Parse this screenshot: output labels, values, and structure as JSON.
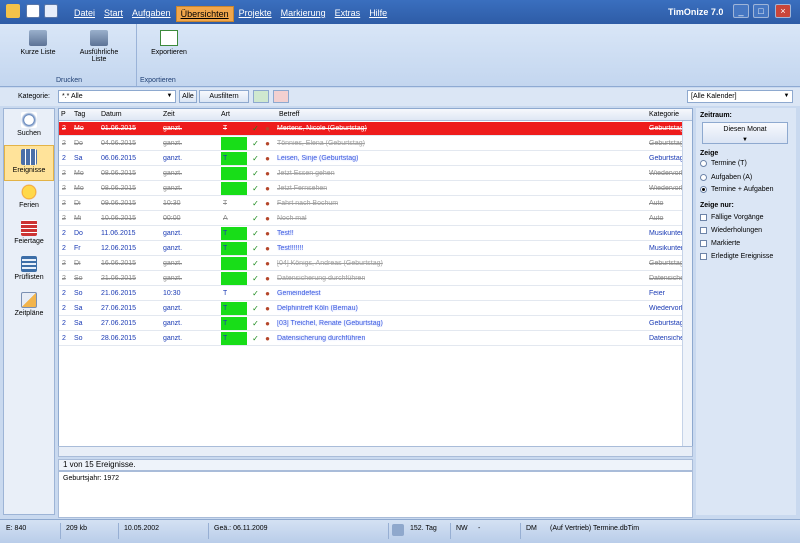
{
  "app": {
    "title": "TimOnize 7.0"
  },
  "menu": {
    "items": [
      "Datei",
      "Start",
      "Aufgaben",
      "Übersichten",
      "Projekte",
      "Markierung",
      "Extras",
      "Hilfe"
    ],
    "active": "Übersichten"
  },
  "ribbon": {
    "kurze_liste": "Kurze Liste",
    "ausfuehrliche_liste_1": "Ausführliche",
    "ausfuehrliche_liste_2": "Liste",
    "exportieren": "Exportieren",
    "group_drucken": "Drucken",
    "group_exportieren": "Exportieren"
  },
  "filter": {
    "kategorie_label": "Kategorie:",
    "kategorie_value": "*.* Alle",
    "alle_button": "Alle",
    "ausfiltern_button": "Ausfiltern",
    "kalender_value": "[Alle Kalender]"
  },
  "sidebar": {
    "items": [
      {
        "label": "Suchen",
        "icon": "magnifier-icon"
      },
      {
        "label": "Ereignisse",
        "icon": "events-grid-icon",
        "selected": true
      },
      {
        "label": "Ferien",
        "icon": "sun-icon"
      },
      {
        "label": "Feiertage",
        "icon": "calendar-icon"
      },
      {
        "label": "Prüflisten",
        "icon": "checklist-icon"
      },
      {
        "label": "Zeitpläne",
        "icon": "schedule-icon"
      }
    ]
  },
  "table": {
    "columns": [
      "P",
      "Tag",
      "Datum",
      "Zeit",
      "Art",
      "Betreff",
      "Kategorie"
    ],
    "rows": [
      {
        "p": "2",
        "tag": "Mo",
        "datum": "01.06.2015",
        "zeit": "ganzt.",
        "art": "T",
        "betreff": "Mertens, Nicole (Geburtstag)",
        "kategorie": "Geburtstag",
        "state": "sel",
        "artgreen": false
      },
      {
        "p": "2",
        "tag": "Do",
        "datum": "04.06.2015",
        "zeit": "ganzt.",
        "art": "",
        "betreff": "Tönnies, Elena (Geburtstag)",
        "kategorie": "Geburtstag",
        "state": "done",
        "artgreen": true
      },
      {
        "p": "2",
        "tag": "Sa",
        "datum": "06.06.2015",
        "zeit": "ganzt.",
        "art": "T",
        "betreff": "Leisen, Sinje (Geburtstag)",
        "kategorie": "Geburtstag",
        "state": "blue",
        "artgreen": true
      },
      {
        "p": "2",
        "tag": "Mo",
        "datum": "08.06.2015",
        "zeit": "ganzt.",
        "art": "",
        "betreff": "Jetzt Essen gehen",
        "kategorie": "Wiedervorl...",
        "state": "done",
        "artgreen": true
      },
      {
        "p": "2",
        "tag": "Mo",
        "datum": "08.06.2015",
        "zeit": "ganzt.",
        "art": "",
        "betreff": "Jetzt Fernsehen",
        "kategorie": "Wiedervorl...",
        "state": "done",
        "artgreen": true
      },
      {
        "p": "2",
        "tag": "Di",
        "datum": "09.06.2015",
        "zeit": "10:30",
        "art": "T",
        "betreff": "Fahrt nach Bochum",
        "kategorie": "Auto",
        "state": "done",
        "artgreen": false
      },
      {
        "p": "2",
        "tag": "Mi",
        "datum": "10.06.2015",
        "zeit": "00:00",
        "art": "A",
        "betreff": "Noch mal",
        "kategorie": "Auto",
        "state": "done",
        "artgreen": false
      },
      {
        "p": "2",
        "tag": "Do",
        "datum": "11.06.2015",
        "zeit": "ganzt.",
        "art": "T",
        "betreff": "Test!!",
        "kategorie": "Musikunterr...",
        "state": "blue",
        "artgreen": true
      },
      {
        "p": "2",
        "tag": "Fr",
        "datum": "12.06.2015",
        "zeit": "ganzt.",
        "art": "T",
        "betreff": "Test!!!!!!!",
        "kategorie": "Musikunterr...",
        "state": "blue",
        "artgreen": true
      },
      {
        "p": "2",
        "tag": "Di",
        "datum": "16.06.2015",
        "zeit": "ganzt.",
        "art": "",
        "betreff": "[04] Königs, Andreas (Geburtstag)",
        "kategorie": "Geburtstag",
        "state": "done",
        "artgreen": true
      },
      {
        "p": "2",
        "tag": "So",
        "datum": "21.06.2015",
        "zeit": "ganzt.",
        "art": "",
        "betreff": "Datensicherung durchführen",
        "kategorie": "Datensiche...",
        "state": "done",
        "artgreen": true
      },
      {
        "p": "2",
        "tag": "So",
        "datum": "21.06.2015",
        "zeit": "10:30",
        "art": "T",
        "betreff": "Gemeindefest",
        "kategorie": "Feier",
        "state": "blue",
        "artgreen": false
      },
      {
        "p": "2",
        "tag": "Sa",
        "datum": "27.06.2015",
        "zeit": "ganzt.",
        "art": "T",
        "betreff": "Delphintreff Köln (Bernau)",
        "kategorie": "Wiedervorl...",
        "state": "blue",
        "artgreen": true
      },
      {
        "p": "2",
        "tag": "Sa",
        "datum": "27.06.2015",
        "zeit": "ganzt.",
        "art": "T",
        "betreff": "[03] Treichel, Renate (Geburtstag)",
        "kategorie": "Geburtstag",
        "state": "blue",
        "artgreen": true
      },
      {
        "p": "2",
        "tag": "So",
        "datum": "28.06.2015",
        "zeit": "ganzt.",
        "art": "T",
        "betreff": "Datensicherung durchführen",
        "kategorie": "Datensiche...",
        "state": "blue",
        "artgreen": true
      }
    ]
  },
  "status": {
    "count_text": "1 von 15 Ereignisse."
  },
  "notes": {
    "text": "Geburtsjahr: 1972"
  },
  "rightpanel": {
    "zeitraum_label": "Zeitraum:",
    "zeitraum_button": "Diesen Monat",
    "zeige_label": "Zeige",
    "options": [
      "Termine (T)",
      "Aufgaben (A)",
      "Termine + Aufgaben"
    ],
    "selected_option": 2,
    "zeige_nur_label": "Zeige nur:",
    "checks": [
      "Fällige Vorgänge",
      "Wiederholungen",
      "Markierte",
      "Erledigte Ereignisse"
    ]
  },
  "bottom": {
    "e": "E: 840",
    "size": "209 kb",
    "date": "10.05.2002",
    "geae": "Geä.: 06.11.2009",
    "tag": "152. Tag",
    "nw": "NW",
    "dash": "-",
    "dm": "DM",
    "file": "(Auf Vertrieb) Termine.dbTim"
  }
}
